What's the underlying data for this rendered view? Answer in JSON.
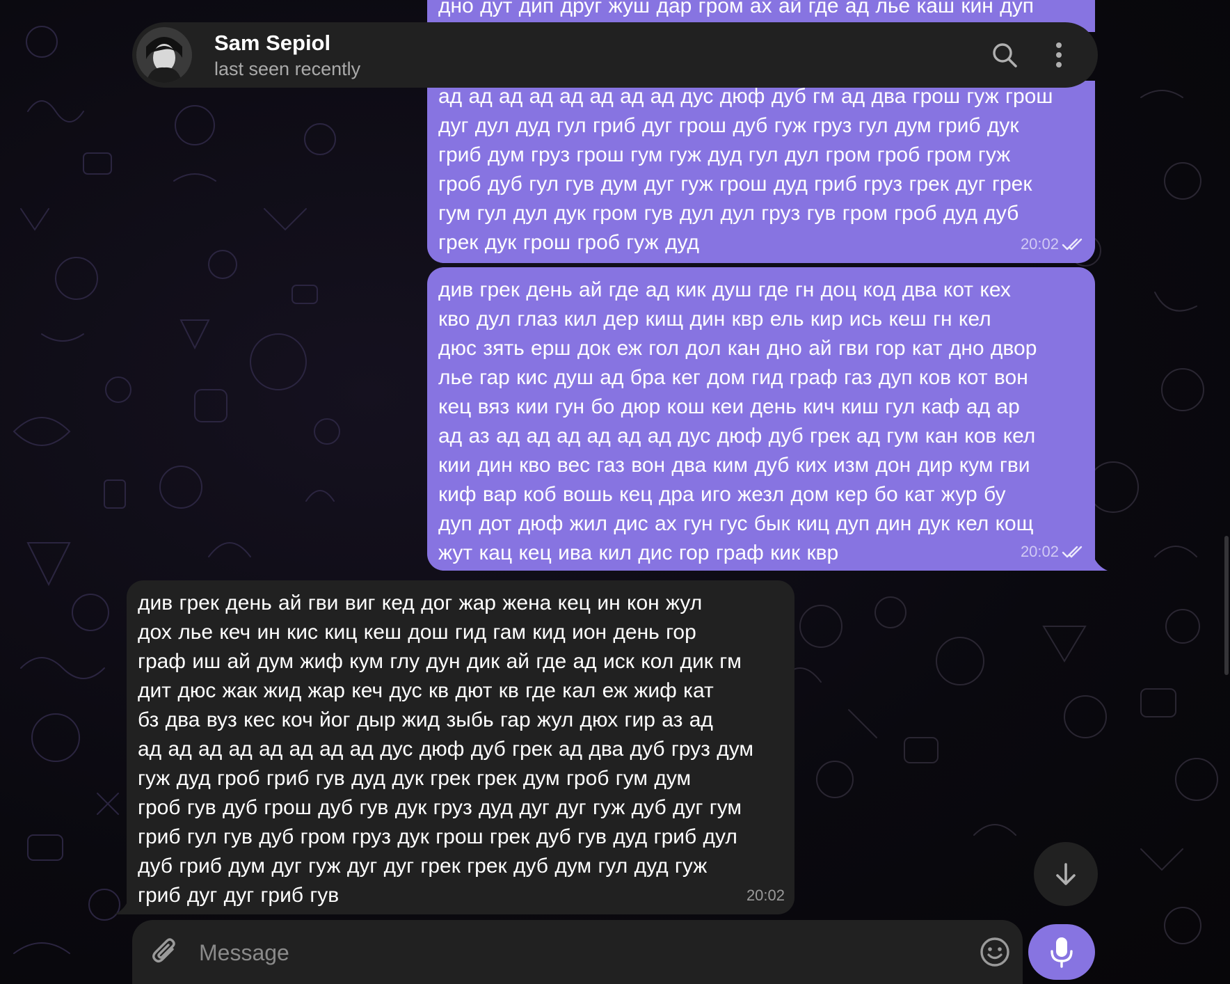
{
  "header": {
    "name": "Sam Sepiol",
    "status": "last seen recently"
  },
  "messages": [
    {
      "direction": "out",
      "text": "дно дут дип друг жуш дар гром ах ай где ад лье каш кин дуп",
      "time": "",
      "status": "partially hidden"
    },
    {
      "direction": "out",
      "text": "ад ад ад ад ад ад ад ад дус дюф дуб гм ад два грош гуж грош\nдуг дул дуд гул гриб дуг грош дуб гуж груз гул дум гриб дук\nгриб дум груз грош гум гуж дуд гул дул гром гроб гром гуж\nгроб дуб гул гув дум дуг гуж грош дуд гриб груз грек дуг грек\nгум гул дул дук гром гув дул дул груз гув гром гроб дуд дуб\nгрек дук грош гроб гуж дуд",
      "time": "20:02",
      "status": "read"
    },
    {
      "direction": "out",
      "text": "див грек день ай где ад кик душ где гн доц код два кот кех\nкво дул глаз кил дер кищ дин квр ель кир ись кеш гн кел\nдюс зять ерш док еж гол дол кан дно ай гви гор кат дно двор\nлье гар кис душ ад бра кег дом гид граф газ дуп ков кот вон\nкец вяз кии гун бо дюр кош кеи день кич киш гул каф ад ар\nад аз ад ад ад ад ад ад дус дюф дуб грек ад гум кан ков кел\nкии дин кво вес газ вон два ким дуб ких изм дон дир кум гви\nкиф вар коб вошь кец дра иго жезл дом кер бо кат жур бу\nдуп дот дюф жил дис ах гун гус бык киц дуп дин дук кел кощ\nжут кац кец ива кил дис гор граф кик квр",
      "time": "20:02",
      "status": "read"
    },
    {
      "direction": "in",
      "text": "див грек день ай гви виг кед дог жар жена кец ин кон жул\nдох лье кеч ин кис киц кеш дош гид гам кид ион день гор\nграф иш ай дум жиф кум глу дун дик ай где ад иск кол дик гм\nдит дюс жак жид жар кеч дус кв дют кв где кал еж жиф кат\nбз два вуз кес коч йог дыр жид зыбь гар жул дюх гир аз ад\nад ад ад ад ад ад ад ад дус дюф дуб грек ад два дуб груз дум\nгуж дуд гроб гриб гув дуд дук грек грек дум гроб гум дум\nгроб гув дуб грош дуб гув дук груз дуд дуг дуг гуж дуб дуг гум\nгриб гул гув дуб гром груз дук грош грек дуб гув дуд гриб дул\nдуб гриб дум дуг гуж дуг дуг грек грек дуб дум гул дуд гуж\nгриб дуг дуг гриб гув",
      "time": "20:02",
      "status": ""
    }
  ],
  "composer": {
    "placeholder": "Message"
  },
  "icons": {
    "search": "search-icon",
    "more": "more-vertical-icon",
    "attach": "paperclip-icon",
    "emoji": "emoji-icon",
    "mic": "microphone-icon",
    "scroll": "arrow-down-icon",
    "read": "double-check-icon"
  },
  "colors": {
    "outgoing_bubble": "#8774e1",
    "incoming_bubble": "#212121",
    "header_bg": "#212121",
    "accent": "#8774e1"
  }
}
